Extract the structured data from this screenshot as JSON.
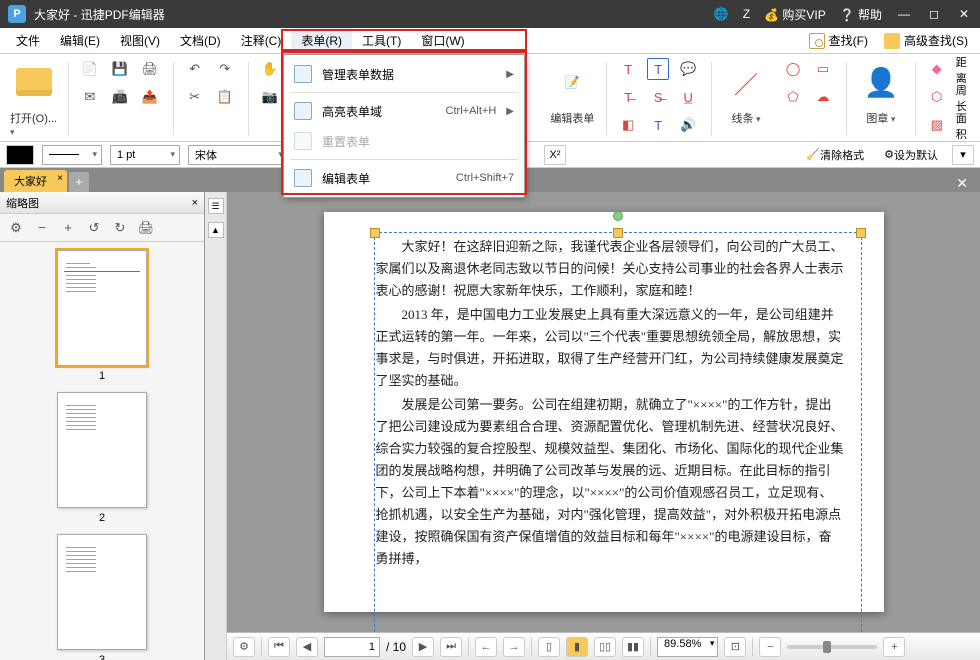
{
  "titlebar": {
    "doc_name": "大家好",
    "app_name": "迅捷PDF编辑器",
    "separator": " - ",
    "user_letter": "Z",
    "buy_vip": "购买VIP",
    "help": "帮助"
  },
  "menubar": {
    "items": [
      "文件",
      "编辑(E)",
      "视图(V)",
      "文档(D)",
      "注释(C)",
      "表单(R)",
      "工具(T)",
      "窗口(W)"
    ],
    "find_label": "查找(F)",
    "adv_find_label": "高级查找(S)"
  },
  "popup": {
    "items": [
      {
        "label": "管理表单数据",
        "shortcut": "",
        "arrow": true,
        "disabled": false
      },
      {
        "label": "高亮表单域",
        "shortcut": "Ctrl+Alt+H",
        "arrow": true,
        "disabled": false
      },
      {
        "label": "重置表单",
        "shortcut": "",
        "arrow": false,
        "disabled": true
      },
      {
        "label": "编辑表单",
        "shortcut": "Ctrl+Shift+7",
        "arrow": false,
        "disabled": false
      }
    ]
  },
  "ribbon": {
    "open_label": "打开(O)...",
    "edit_form_label": "编辑表单",
    "lines_label": "线条",
    "stamp_label": "图章",
    "distance_label": "距离",
    "perimeter_label": "周长",
    "area_label": "面积"
  },
  "propsbar": {
    "stroke_label": "1 pt",
    "font_label": "宋体",
    "clear_format": "清除格式",
    "set_default": "设为默认",
    "superscript": "X²"
  },
  "tabs": {
    "active": "大家好"
  },
  "sidepanel": {
    "title": "缩略图",
    "page_numbers": [
      "1",
      "2",
      "3"
    ]
  },
  "document": {
    "paragraphs": [
      "大家好！在这辞旧迎新之际，我谨代表企业各层领导们，向公司的广大员工、家属们以及离退休老同志致以节日的问候！关心支持公司事业的社会各界人士表示衷心的感谢！祝愿大家新年快乐，工作顺利，家庭和睦！",
      "2013 年，是中国电力工业发展史上具有重大深远意义的一年，是公司组建并正式运转的第一年。一年来，公司以\"三个代表\"重要思想统领全局，解放思想，实事求是，与时俱进，开拓进取，取得了生产经营开门红，为公司持续健康发展奠定了坚实的基础。",
      "发展是公司第一要务。公司在组建初期，就确立了\"××××\"的工作方针，提出了把公司建设成为要素组合合理、资源配置优化、管理机制先进、经营状况良好、综合实力较强的复合控股型、规模效益型、集团化、市场化、国际化的现代企业集团的发展战略构想，并明确了公司改革与发展的远、近期目标。在此目标的指引下，公司上下本着\"××××\"的理念，以\"××××\"的公司价值观感召员工，立足现有、抢抓机遇，以安全生产为基础，对内\"强化管理，提高效益\"，对外积极开拓电源点建设，按照确保国有资产保值增值的效益目标和每年\"××××\"的电源建设目标，奋勇拼搏，"
    ]
  },
  "statusbar": {
    "page_current": "1",
    "page_total": "10",
    "page_sep": " / ",
    "zoom": "89.58%"
  }
}
